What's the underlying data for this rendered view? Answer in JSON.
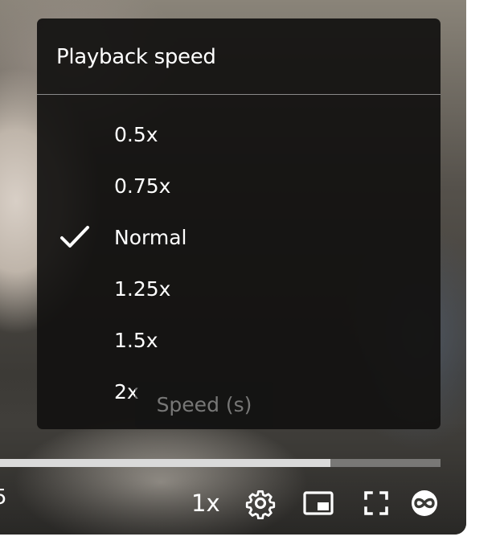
{
  "menu": {
    "title": "Playback speed",
    "items": [
      {
        "label": "0.5x",
        "selected": false
      },
      {
        "label": "0.75x",
        "selected": false
      },
      {
        "label": "Normal",
        "selected": true
      },
      {
        "label": "1.25x",
        "selected": false
      },
      {
        "label": "1.5x",
        "selected": false
      },
      {
        "label": "2x",
        "selected": false
      }
    ]
  },
  "tooltip": "Speed (s)",
  "controls": {
    "time_fragment": "5",
    "speed_label": "1x",
    "icons": [
      "settings-gear-icon",
      "picture-in-picture-icon",
      "fullscreen-icon",
      "loop-icon"
    ]
  },
  "progress": {
    "played_fraction": 0.75
  },
  "colors": {
    "menu_bg": "#121110",
    "text": "#ffffff",
    "divider": "#8a8a8a",
    "progress_played": "#dadada"
  }
}
